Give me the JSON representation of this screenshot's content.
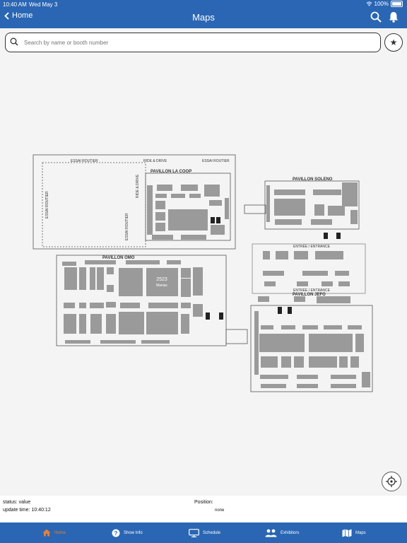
{
  "status_bar": {
    "time": "10:40 AM",
    "date": "Wed May 3",
    "battery": "100%"
  },
  "nav": {
    "back_label": "Home",
    "title": "Maps"
  },
  "search": {
    "placeholder": "Search by name or booth number"
  },
  "map": {
    "labels": {
      "essai_routier_top": "ESSAI ROUTIER",
      "ride_drive": "RIDE & DRIVE",
      "essai_routier_top2": "ESSAI ROUTIER",
      "pavillon_la_coop": "PAVILLON LA COOP",
      "pavillon_soleno": "PAVILLON SOLENO",
      "pavillon_omo": "PAVILLON OMO",
      "pavillon_jefo": "PAVILLON JEFO",
      "entree_1": "ENTRÉE / ENTRANCE",
      "entree_2": "ENTRÉE / ENTRANCE",
      "essai_routier_left": "ESSAI ROUTIER",
      "essai_routier_left2": "ESSAI ROUTIER",
      "ride_drive_vertical": "RIDE & DRIVE",
      "booth_2523": "2523",
      "booth_2523_name": "Maniac"
    }
  },
  "info_panel": {
    "status": "status: value",
    "update_time": "update time:  10:40:12",
    "position_label": "Position:",
    "position_value": "none"
  },
  "tabs": [
    {
      "label": "Home",
      "icon": "home-icon",
      "active": true
    },
    {
      "label": "Show Info",
      "icon": "help-circle-icon",
      "active": false
    },
    {
      "label": "Schedule",
      "icon": "monitor-icon",
      "active": false
    },
    {
      "label": "Exhibitors",
      "icon": "people-icon",
      "active": false
    },
    {
      "label": "Maps",
      "icon": "map-icon",
      "active": false
    }
  ],
  "colors": {
    "header": "#2a66b3",
    "active_tab": "#e2813b",
    "booth": "#9a9a9a"
  }
}
